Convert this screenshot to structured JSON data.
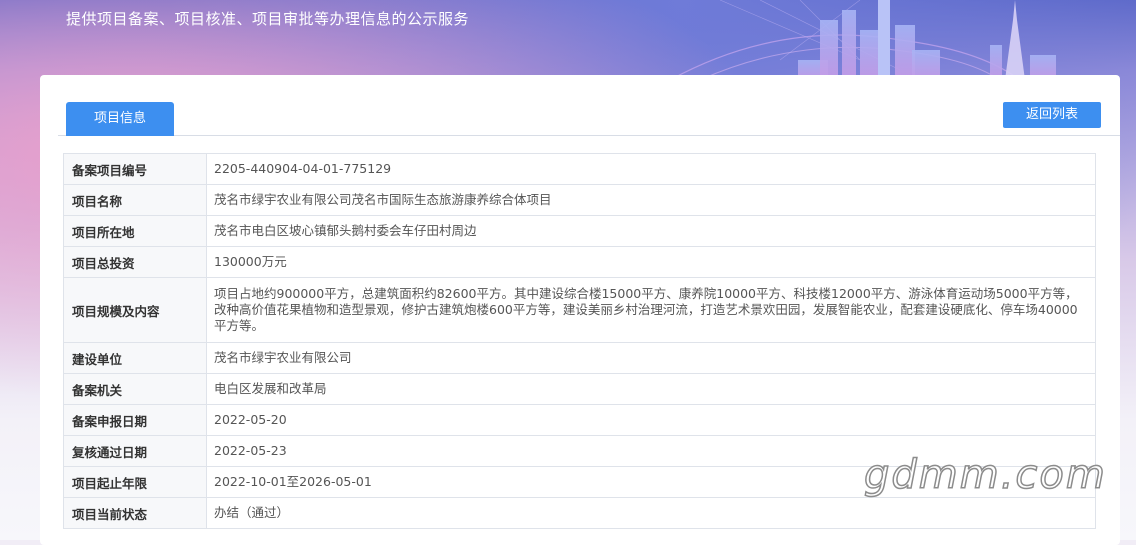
{
  "header": {
    "subtitle": "提供项目备案、项目核准、项目审批等办理信息的公示服务"
  },
  "tabs": [
    {
      "label": "项目信息",
      "active": true
    }
  ],
  "back_button": "返回列表",
  "rows": [
    {
      "label": "备案项目编号",
      "value": "2205-440904-04-01-775129"
    },
    {
      "label": "项目名称",
      "value": "茂名市绿宇农业有限公司茂名市国际生态旅游康养综合体项目"
    },
    {
      "label": "项目所在地",
      "value": "茂名市电白区坡心镇郁头鹅村委会车仔田村周边"
    },
    {
      "label": "项目总投资",
      "value": "130000万元"
    },
    {
      "label": "项目规模及内容",
      "value": "项目占地约900000平方，总建筑面积约82600平方。其中建设综合楼15000平方、康养院10000平方、科技楼12000平方、游泳体育运动场5000平方等，改种高价值花果植物和造型景观，修护古建筑炮楼600平方等，建设美丽乡村治理河流，打造艺术景欢田园，发展智能农业，配套建设硬底化、停车场40000平方等。"
    },
    {
      "label": "建设单位",
      "value": "茂名市绿宇农业有限公司"
    },
    {
      "label": "备案机关",
      "value": "电白区发展和改革局"
    },
    {
      "label": "备案申报日期",
      "value": "2022-05-20"
    },
    {
      "label": "复核通过日期",
      "value": "2022-05-23"
    },
    {
      "label": "项目起止年限",
      "value": "2022-10-01至2026-05-01"
    },
    {
      "label": "项目当前状态",
      "value": "办结（通过）"
    }
  ],
  "watermark": "gdmm.com",
  "colors": {
    "accent": "#3d8ff0",
    "banner": "#5c68c8"
  }
}
